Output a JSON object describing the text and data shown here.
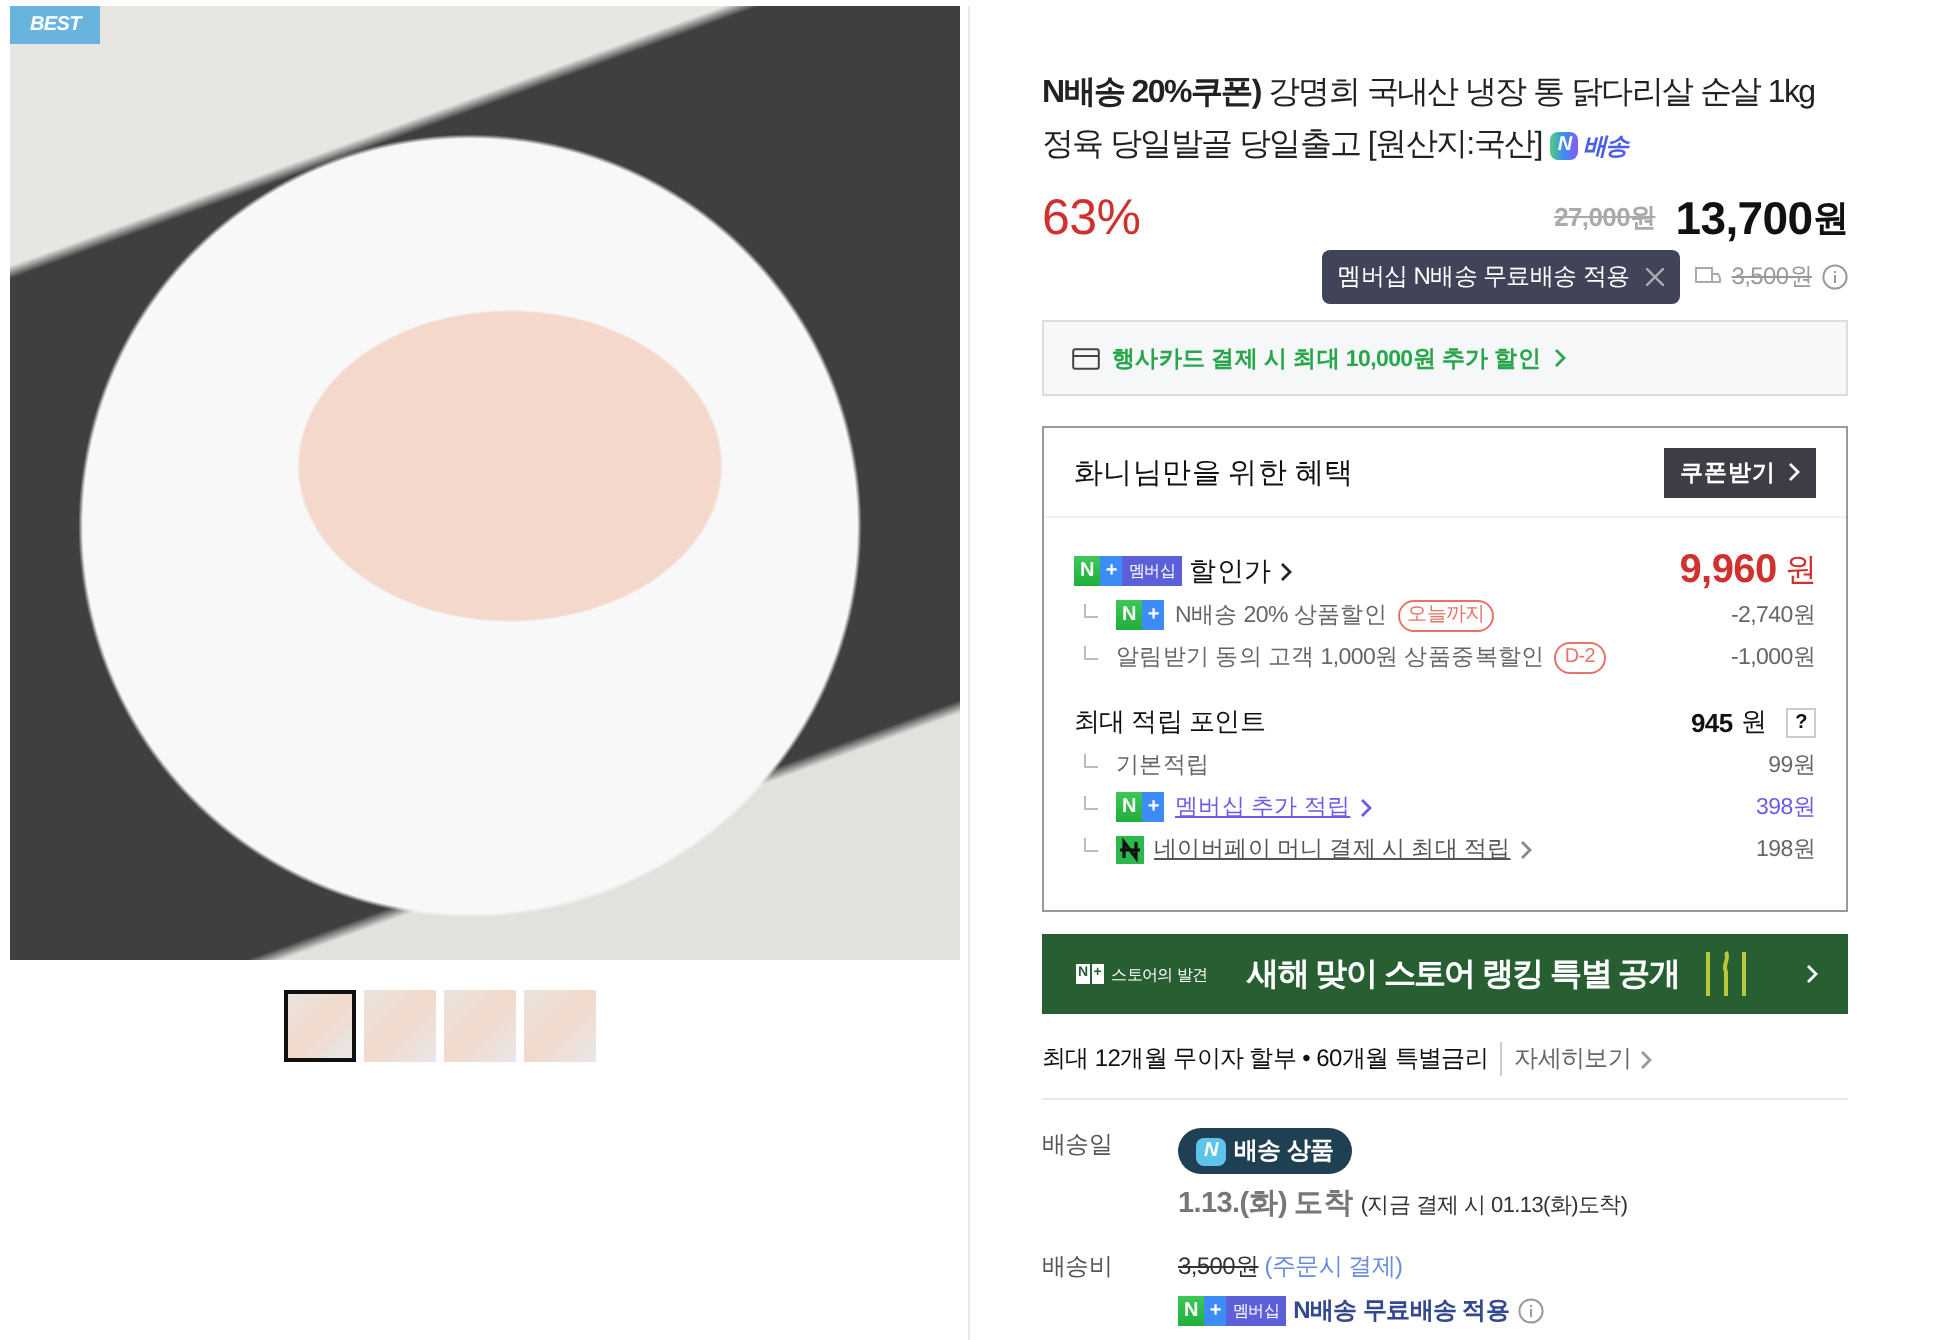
{
  "gallery": {
    "badge": "BEST",
    "thumbnails": [
      {
        "selected": true
      },
      {
        "selected": false
      },
      {
        "selected": false
      },
      {
        "selected": false
      }
    ]
  },
  "product": {
    "title": "**N배송 20%쿠폰)** 강명희 국내산 냉장 통 닭다리살 순살 1kg 정육 당일발골 당일출고 [원산지:국산]",
    "delivery_badge": {
      "logo": "N",
      "text": "배송"
    },
    "discount_rate": "63%",
    "original_price": "27,000원",
    "price": "13,700",
    "currency": "원",
    "tooltip": "멤버십 N배송 무료배송 적용",
    "shipping_fee": "3,500원"
  },
  "card_promo": "행사카드 결제 시 최대 10,000원 추가 할인",
  "benefits": {
    "title": "화니님만을 위한 혜택",
    "coupon_button": "쿠폰받기",
    "sale": {
      "badge": [
        "N",
        "+",
        "멤버십"
      ],
      "label": "할인가",
      "amount": "9,960",
      "unit": "원"
    },
    "discounts": [
      {
        "badge": [
          "N",
          "+"
        ],
        "text": "N배송 20% 상품할인",
        "tag": "오늘까지",
        "amount": "-2,740원"
      },
      {
        "text": "알림받기 동의 고객 1,000원 상품중복할인",
        "tag": "D-2",
        "amount": "-1,000원"
      }
    ],
    "points": {
      "label": "최대 적립 포인트",
      "amount": "945",
      "unit": "원",
      "help": "?"
    },
    "point_items": [
      {
        "kind": "plain",
        "text": "기본적립",
        "amount": "99원"
      },
      {
        "kind": "membership",
        "badge": [
          "N",
          "+"
        ],
        "text": "멤버십 추가 적립",
        "amount": "398원"
      },
      {
        "kind": "npay",
        "text": "네이버페이 머니 결제 시 최대 적립",
        "amount": "198원"
      }
    ]
  },
  "banner": {
    "brand": [
      "N",
      "+"
    ],
    "brand_text": "스토어의 발견",
    "text": "새해 맞이 스토어 랭킹 특별 공개"
  },
  "installment": {
    "text": "최대 12개월 무이자 할부 • 60개월 특별금리",
    "more": "자세히보기"
  },
  "delivery": {
    "date_label": "배송일",
    "badge": {
      "logo": "N",
      "text": "배송 상품"
    },
    "arrival": "1.13.(화) 도착",
    "arrival_note": "(지금 결제 시 01.13(화)도착)",
    "fee_label": "배송비",
    "fee": "3,500원",
    "fee_note": "(주문시 결제)",
    "membership_badge": [
      "N",
      "+",
      "멤버십"
    ],
    "membership_text": "N배송 무료배송 적용"
  }
}
